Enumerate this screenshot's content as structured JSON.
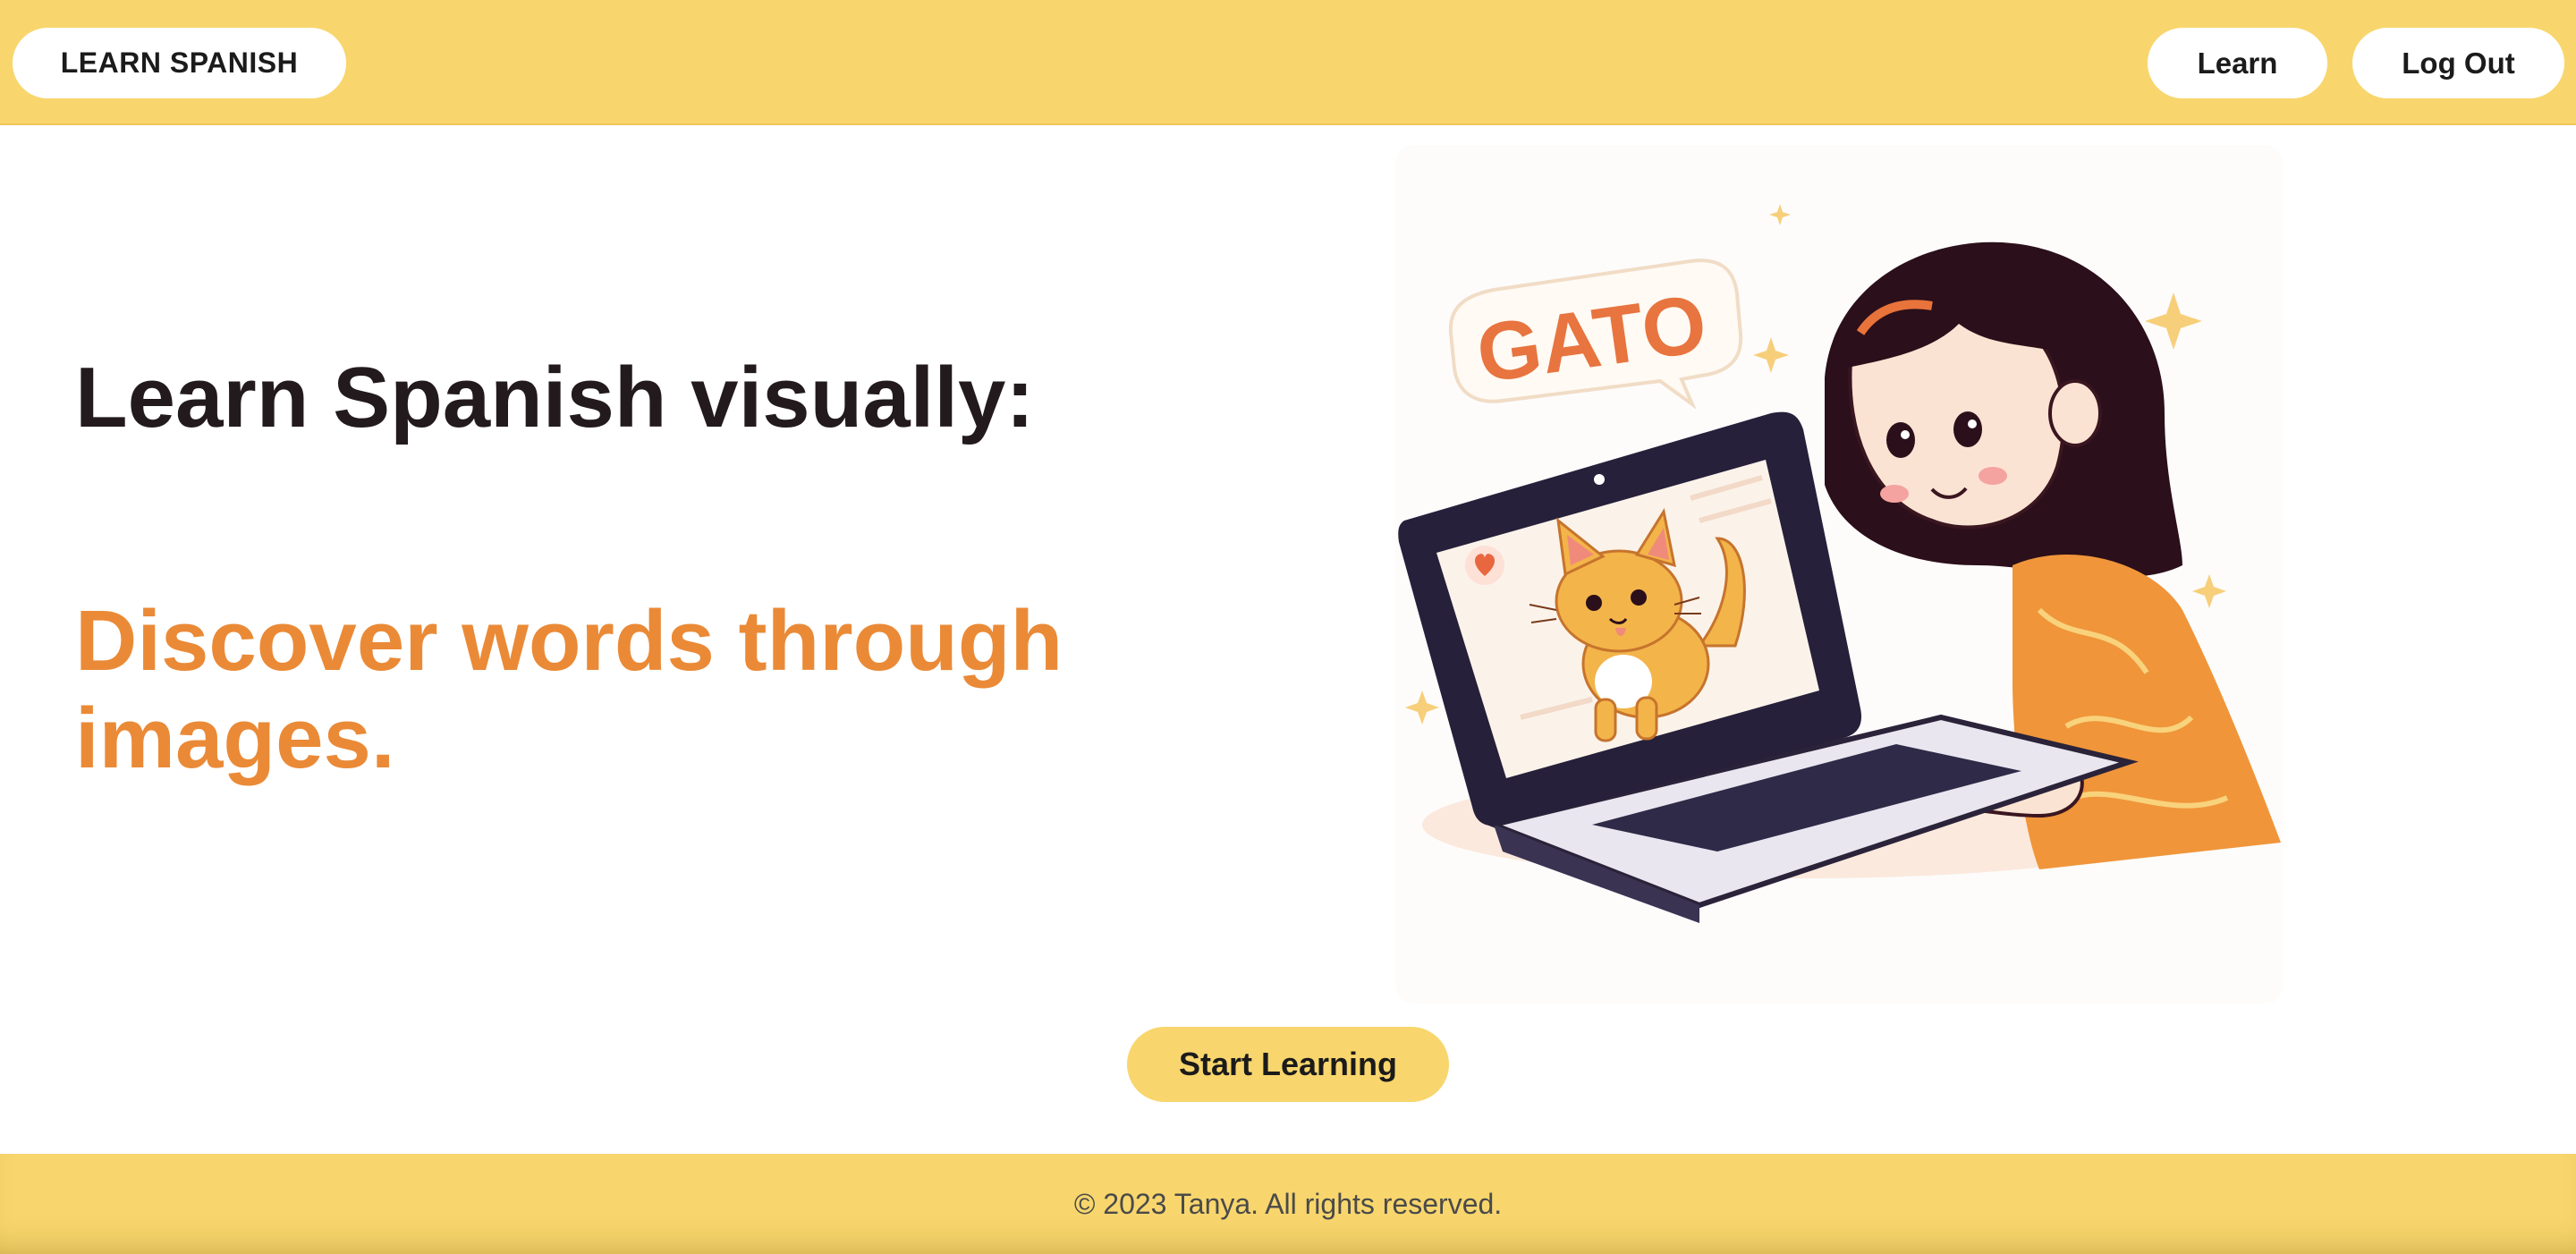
{
  "header": {
    "brand_label": "LEARN SPANISH",
    "nav": {
      "learn_label": "Learn",
      "logout_label": "Log Out"
    }
  },
  "hero": {
    "headline": "Learn Spanish visually:",
    "subline": "Discover words through images.",
    "illustration": {
      "speech_bubble_word": "GATO",
      "description_icons": [
        "heart-icon",
        "cat-illustration",
        "laptop-illustration",
        "girl-illustration",
        "sparkle-icon"
      ]
    },
    "cta_label": "Start Learning"
  },
  "footer": {
    "copyright": "© 2023 Tanya. All rights reserved."
  },
  "colors": {
    "brand_yellow": "#f8d66d",
    "accent_orange": "#ea8a37",
    "heading_dark": "#231a1d",
    "footer_text": "#4a4a4a"
  }
}
